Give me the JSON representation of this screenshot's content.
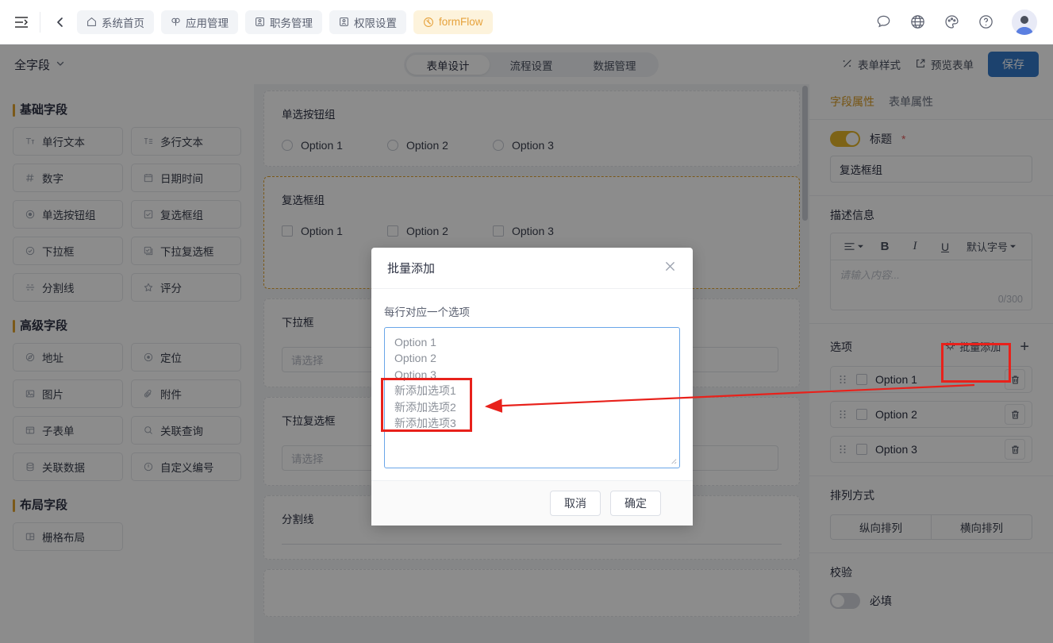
{
  "topbar": {
    "collapse_icon": "sidebar-collapse-icon",
    "back_icon": "back-chevron-icon",
    "tabs": [
      {
        "label": "系统首页",
        "icon": "home-icon",
        "active": false
      },
      {
        "label": "应用管理",
        "icon": "apps-icon",
        "active": false
      },
      {
        "label": "职务管理",
        "icon": "badge-icon",
        "active": false
      },
      {
        "label": "权限设置",
        "icon": "badge-icon",
        "active": false
      },
      {
        "label": "formFlow",
        "icon": "flow-icon",
        "active": true
      }
    ],
    "actions": [
      "message-icon",
      "globe-icon",
      "palette-icon",
      "help-icon"
    ],
    "avatar": "user-avatar"
  },
  "subbar": {
    "all_fields": "全字段",
    "all_fields_icon": "chevron-down-icon",
    "segments": [
      {
        "label": "表单设计",
        "active": true
      },
      {
        "label": "流程设置",
        "active": false
      },
      {
        "label": "数据管理",
        "active": false
      }
    ],
    "form_style": "表单样式",
    "form_style_icon": "style-icon",
    "preview": "预览表单",
    "preview_icon": "external-link-icon",
    "save": "保存",
    "save_color": "#3478c8"
  },
  "left_panel": {
    "groups": [
      {
        "title": "基础字段",
        "items": [
          {
            "label": "单行文本",
            "icon": "text-single-icon"
          },
          {
            "label": "多行文本",
            "icon": "text-multi-icon"
          },
          {
            "label": "数字",
            "icon": "hash-icon"
          },
          {
            "label": "日期时间",
            "icon": "calendar-icon"
          },
          {
            "label": "单选按钮组",
            "icon": "radio-icon"
          },
          {
            "label": "复选框组",
            "icon": "checkbox-icon"
          },
          {
            "label": "下拉框",
            "icon": "select-icon"
          },
          {
            "label": "下拉复选框",
            "icon": "multiselect-icon"
          },
          {
            "label": "分割线",
            "icon": "divider-icon"
          },
          {
            "label": "评分",
            "icon": "star-icon"
          }
        ]
      },
      {
        "title": "高级字段",
        "items": [
          {
            "label": "地址",
            "icon": "address-icon"
          },
          {
            "label": "定位",
            "icon": "location-icon"
          },
          {
            "label": "图片",
            "icon": "image-icon"
          },
          {
            "label": "附件",
            "icon": "attachment-icon"
          },
          {
            "label": "子表单",
            "icon": "subform-icon"
          },
          {
            "label": "关联查询",
            "icon": "search-icon"
          },
          {
            "label": "关联数据",
            "icon": "database-icon"
          },
          {
            "label": "自定义编号",
            "icon": "number-icon"
          }
        ]
      },
      {
        "title": "布局字段",
        "items": [
          {
            "label": "栅格布局",
            "icon": "grid-icon"
          }
        ]
      }
    ]
  },
  "canvas": {
    "fields": [
      {
        "label": "单选按钮组",
        "type": "radio-group",
        "selected": false,
        "options": [
          "Option 1",
          "Option 2",
          "Option 3"
        ]
      },
      {
        "label": "复选框组",
        "type": "checkbox-group",
        "selected": true,
        "options": [
          "Option 1",
          "Option 2",
          "Option 3"
        ]
      },
      {
        "label": "下拉框",
        "type": "select",
        "selected": false,
        "placeholder": "请选择"
      },
      {
        "label": "下拉复选框",
        "type": "multiselect",
        "selected": false,
        "placeholder": "请选择"
      },
      {
        "label": "分割线",
        "type": "divider",
        "selected": false
      }
    ]
  },
  "right_panel": {
    "tabs": [
      {
        "label": "字段属性",
        "active": true
      },
      {
        "label": "表单属性",
        "active": false
      }
    ],
    "title_section": {
      "toggle_on": true,
      "label": "标题",
      "required_mark": "*",
      "value": "复选框组"
    },
    "desc_section": {
      "heading": "描述信息",
      "toolbar": {
        "align": "align-icon",
        "align_caret": "caret-down-icon",
        "bold": "B",
        "italic": "I",
        "underline": "U",
        "font_size": "默认字号",
        "font_size_caret": "caret-down-icon"
      },
      "placeholder": "请输入内容...",
      "counter": "0/300"
    },
    "options_section": {
      "heading": "选项",
      "batch_add": "批量添加",
      "batch_add_icon": "batch-icon",
      "add_icon": "plus-icon",
      "items": [
        {
          "label": "Option 1",
          "checked": false
        },
        {
          "label": "Option 2",
          "checked": false
        },
        {
          "label": "Option 3",
          "checked": false
        }
      ],
      "delete_icon": "trash-icon",
      "drag_icon": "drag-handle-icon"
    },
    "arrange_section": {
      "heading": "排列方式",
      "options": [
        "纵向排列",
        "横向排列"
      ],
      "selected": "横向排列"
    },
    "validate_section": {
      "heading": "校验",
      "required_label": "必填",
      "required_on": false
    }
  },
  "modal": {
    "title": "批量添加",
    "close_icon": "close-icon",
    "hint": "每行对应一个选项",
    "textarea_value": "Option 1\nOption 2\nOption 3\n新添加选项1\n新添加选项2\n新添加选项3",
    "cancel": "取消",
    "confirm": "确定"
  },
  "annotations": {
    "highlight_color": "#e8211b",
    "boxes": [
      "new-options-lines",
      "batch-add-button"
    ],
    "arrow": "points from 批量添加 button to newly added option lines"
  }
}
